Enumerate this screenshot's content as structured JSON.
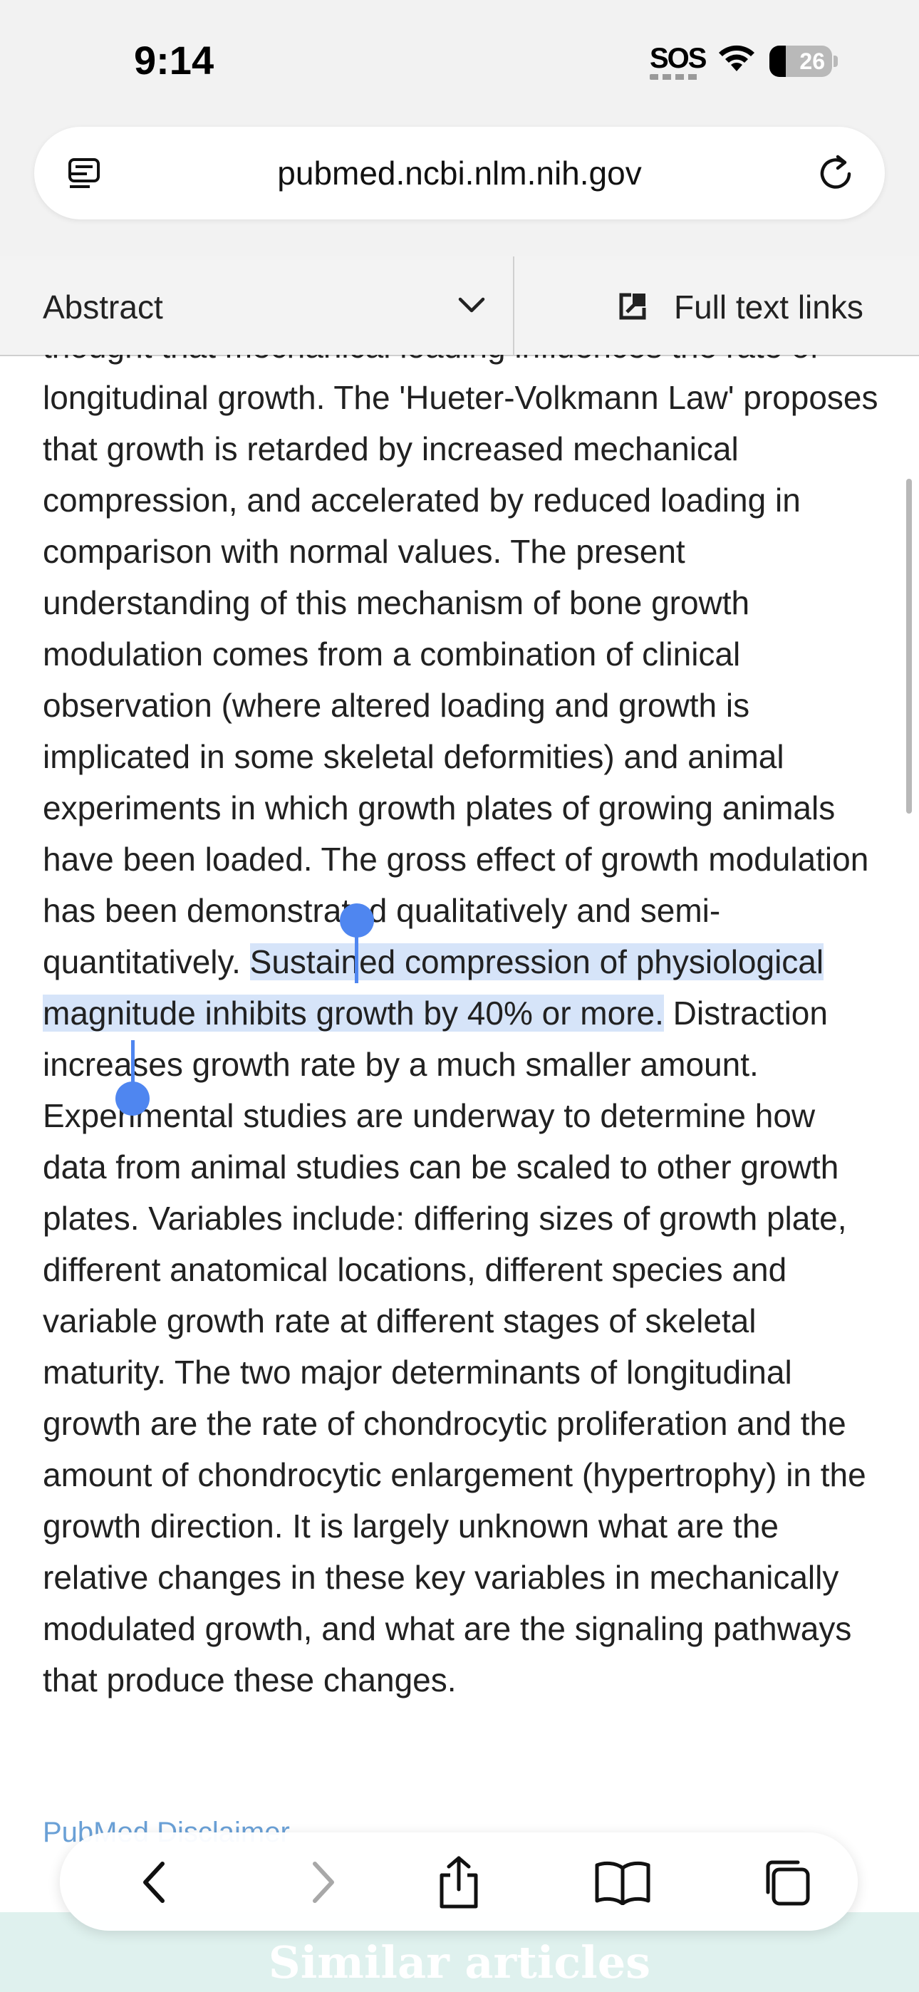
{
  "status_bar": {
    "time": "9:14",
    "carrier": "SOS",
    "battery": "26",
    "battery_level": 0.26
  },
  "browser": {
    "url": "pubmed.ncbi.nlm.nih.gov",
    "icons": [
      "reader-icon",
      "reload-icon"
    ]
  },
  "section_bar": {
    "selected": "Abstract",
    "full_text_label": "Full text links",
    "icons": [
      "chevron-down-icon",
      "external-link-icon"
    ]
  },
  "abstract": {
    "cut_off_line": "thought that mechanical loading influences the rate",
    "before_selection": "of longitudinal growth. The 'Hueter-Volkmann Law' proposes that growth is retarded by increased mechanical compression, and accelerated by reduced loading in comparison with normal values. The present understanding of this mechanism of bone growth modulation comes from a combination of clinical observation (where altered loading and growth is implicated in some skeletal deformities) and animal experiments in which growth plates of growing animals have been loaded. The gross effect of growth modulation has been demonstrated qualitatively and semi-quantitatively. ",
    "selected_text": "Sustained compression of physiological magnitude inhibits growth by 40% or more.",
    "after_selection": " Distraction increases growth rate by a much smaller amount. Experimental studies are underway to determine how data from animal studies can be scaled to other growth plates. Variables include: differing sizes of growth plate, different anatomical locations, different species and variable growth rate at different stages of skeletal maturity. The two major determinants of longitudinal growth are the rate of chondrocytic proliferation and the amount of chondrocytic enlargement (hypertrophy) in the growth direction. It is largely unknown what are the relative changes in these key variables in mechanically modulated growth, and what are the signaling pathways that produce these changes."
  },
  "disclaimer": "PubMed Disclaimer",
  "similar_articles": "Similar articles",
  "toolbar": {
    "buttons": [
      "back-icon",
      "forward-icon",
      "share-icon",
      "bookmarks-icon",
      "tabs-icon"
    ]
  },
  "colors": {
    "selection": "#d6e4f9",
    "handle": "#4f86f0",
    "link": "#6aa0d6",
    "similar_band": "#dff1ee"
  }
}
